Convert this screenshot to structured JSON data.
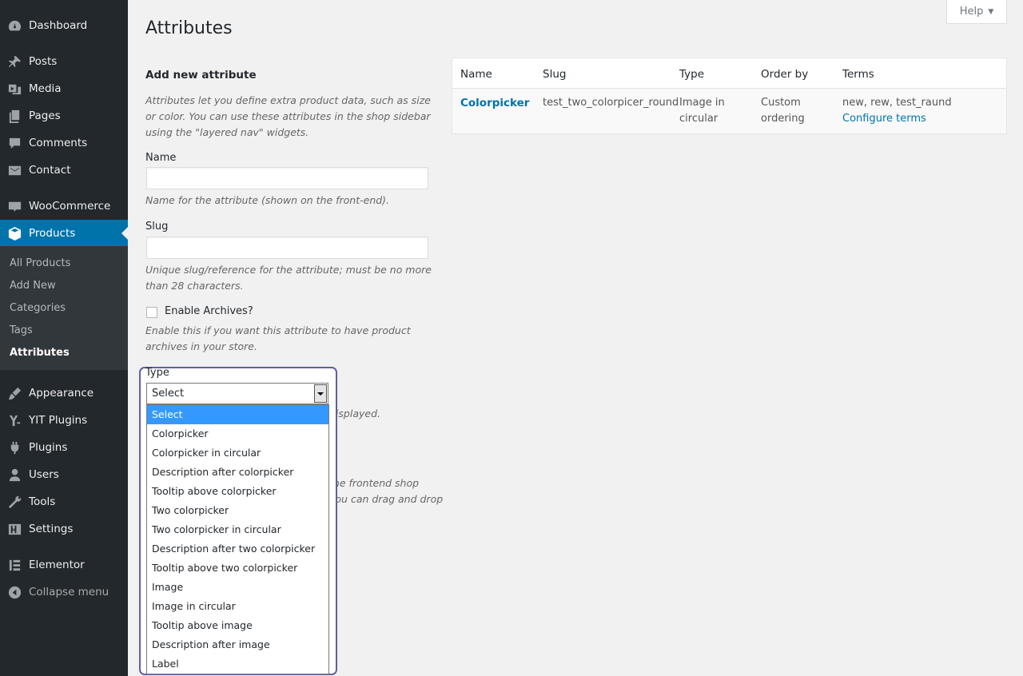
{
  "sidebar": {
    "items": [
      {
        "label": "Dashboard",
        "icon": "dashboard-icon"
      },
      {
        "label": "Posts",
        "icon": "pin-icon"
      },
      {
        "label": "Media",
        "icon": "media-icon"
      },
      {
        "label": "Pages",
        "icon": "pages-icon"
      },
      {
        "label": "Comments",
        "icon": "comment-icon"
      },
      {
        "label": "Contact",
        "icon": "mail-icon"
      },
      {
        "label": "WooCommerce",
        "icon": "woocommerce-icon"
      },
      {
        "label": "Products",
        "icon": "product-box-icon"
      },
      {
        "label": "Appearance",
        "icon": "brush-icon"
      },
      {
        "label": "YIT Plugins",
        "icon": "yit-icon"
      },
      {
        "label": "Plugins",
        "icon": "plugin-icon"
      },
      {
        "label": "Users",
        "icon": "user-icon"
      },
      {
        "label": "Tools",
        "icon": "wrench-icon"
      },
      {
        "label": "Settings",
        "icon": "settings-icon"
      },
      {
        "label": "Elementor",
        "icon": "elementor-icon"
      },
      {
        "label": "Collapse menu",
        "icon": "collapse-icon"
      }
    ],
    "submenu": [
      "All Products",
      "Add New",
      "Categories",
      "Tags",
      "Attributes"
    ]
  },
  "help": {
    "label": "Help"
  },
  "page": {
    "title": "Attributes"
  },
  "form": {
    "heading": "Add new attribute",
    "intro": "Attributes let you define extra product data, such as size or color. You can use these attributes in the shop sidebar using the \"layered nav\" widgets.",
    "name_label": "Name",
    "name_value": "",
    "name_desc": "Name for the attribute (shown on the front-end).",
    "slug_label": "Slug",
    "slug_value": "",
    "slug_desc": "Unique slug/reference for the attribute; must be no more than 28 characters.",
    "archives_label": "Enable Archives?",
    "archives_checked": false,
    "archives_desc": "Enable this if you want this attribute to have product archives in your store.",
    "type_label": "Type",
    "type_selected": "Select",
    "type_options": [
      "Select",
      "Colorpicker",
      "Colorpicker in circular",
      "Description after colorpicker",
      "Tooltip above colorpicker",
      "Two colorpicker",
      "Two colorpicker in circular",
      "Description after two colorpicker",
      "Tooltip above two colorpicker",
      "Image",
      "Image in circular",
      "Tooltip above image",
      "Description after image",
      "Label"
    ],
    "peek_text_1": "displayed.",
    "peek_text_2": "the frontend shop",
    "peek_text_3": "you can drag and drop"
  },
  "table": {
    "headers": [
      "Name",
      "Slug",
      "Type",
      "Order by",
      "Terms"
    ],
    "rows": [
      {
        "name": "Colorpicker",
        "slug": "test_two_colorpicer_round",
        "type_line1": "Image in",
        "type_line2": "circular",
        "order_line1": "Custom",
        "order_line2": "ordering",
        "terms": "new, rew, test_raund",
        "configure": "Configure terms"
      }
    ]
  },
  "colors": {
    "sidebar_bg": "#23282d",
    "accent": "#0073aa",
    "highlight_border": "#5f5fa3",
    "option_selected": "#3399ff"
  }
}
